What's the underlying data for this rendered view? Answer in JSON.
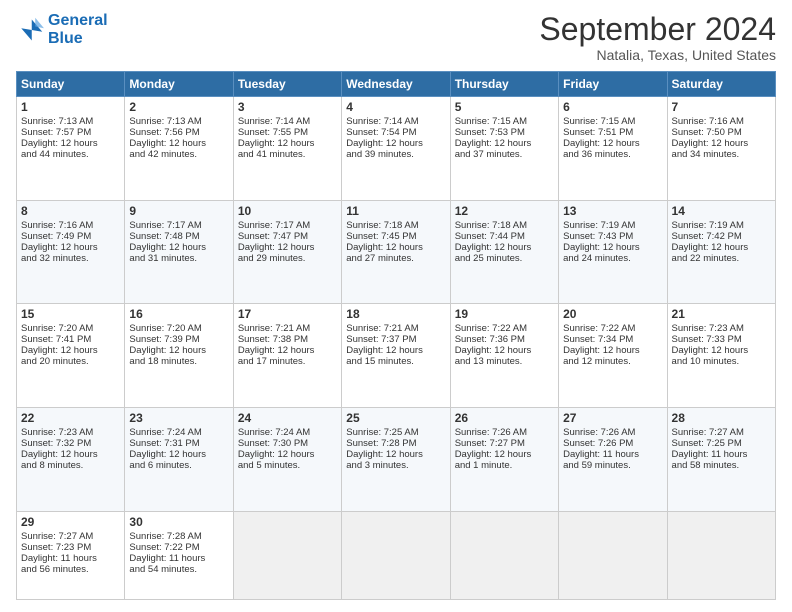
{
  "logo": {
    "line1": "General",
    "line2": "Blue"
  },
  "header": {
    "month": "September 2024",
    "location": "Natalia, Texas, United States"
  },
  "weekdays": [
    "Sunday",
    "Monday",
    "Tuesday",
    "Wednesday",
    "Thursday",
    "Friday",
    "Saturday"
  ],
  "weeks": [
    [
      {
        "day": "1",
        "lines": [
          "Sunrise: 7:13 AM",
          "Sunset: 7:57 PM",
          "Daylight: 12 hours",
          "and 44 minutes."
        ]
      },
      {
        "day": "2",
        "lines": [
          "Sunrise: 7:13 AM",
          "Sunset: 7:56 PM",
          "Daylight: 12 hours",
          "and 42 minutes."
        ]
      },
      {
        "day": "3",
        "lines": [
          "Sunrise: 7:14 AM",
          "Sunset: 7:55 PM",
          "Daylight: 12 hours",
          "and 41 minutes."
        ]
      },
      {
        "day": "4",
        "lines": [
          "Sunrise: 7:14 AM",
          "Sunset: 7:54 PM",
          "Daylight: 12 hours",
          "and 39 minutes."
        ]
      },
      {
        "day": "5",
        "lines": [
          "Sunrise: 7:15 AM",
          "Sunset: 7:53 PM",
          "Daylight: 12 hours",
          "and 37 minutes."
        ]
      },
      {
        "day": "6",
        "lines": [
          "Sunrise: 7:15 AM",
          "Sunset: 7:51 PM",
          "Daylight: 12 hours",
          "and 36 minutes."
        ]
      },
      {
        "day": "7",
        "lines": [
          "Sunrise: 7:16 AM",
          "Sunset: 7:50 PM",
          "Daylight: 12 hours",
          "and 34 minutes."
        ]
      }
    ],
    [
      {
        "day": "8",
        "lines": [
          "Sunrise: 7:16 AM",
          "Sunset: 7:49 PM",
          "Daylight: 12 hours",
          "and 32 minutes."
        ]
      },
      {
        "day": "9",
        "lines": [
          "Sunrise: 7:17 AM",
          "Sunset: 7:48 PM",
          "Daylight: 12 hours",
          "and 31 minutes."
        ]
      },
      {
        "day": "10",
        "lines": [
          "Sunrise: 7:17 AM",
          "Sunset: 7:47 PM",
          "Daylight: 12 hours",
          "and 29 minutes."
        ]
      },
      {
        "day": "11",
        "lines": [
          "Sunrise: 7:18 AM",
          "Sunset: 7:45 PM",
          "Daylight: 12 hours",
          "and 27 minutes."
        ]
      },
      {
        "day": "12",
        "lines": [
          "Sunrise: 7:18 AM",
          "Sunset: 7:44 PM",
          "Daylight: 12 hours",
          "and 25 minutes."
        ]
      },
      {
        "day": "13",
        "lines": [
          "Sunrise: 7:19 AM",
          "Sunset: 7:43 PM",
          "Daylight: 12 hours",
          "and 24 minutes."
        ]
      },
      {
        "day": "14",
        "lines": [
          "Sunrise: 7:19 AM",
          "Sunset: 7:42 PM",
          "Daylight: 12 hours",
          "and 22 minutes."
        ]
      }
    ],
    [
      {
        "day": "15",
        "lines": [
          "Sunrise: 7:20 AM",
          "Sunset: 7:41 PM",
          "Daylight: 12 hours",
          "and 20 minutes."
        ]
      },
      {
        "day": "16",
        "lines": [
          "Sunrise: 7:20 AM",
          "Sunset: 7:39 PM",
          "Daylight: 12 hours",
          "and 18 minutes."
        ]
      },
      {
        "day": "17",
        "lines": [
          "Sunrise: 7:21 AM",
          "Sunset: 7:38 PM",
          "Daylight: 12 hours",
          "and 17 minutes."
        ]
      },
      {
        "day": "18",
        "lines": [
          "Sunrise: 7:21 AM",
          "Sunset: 7:37 PM",
          "Daylight: 12 hours",
          "and 15 minutes."
        ]
      },
      {
        "day": "19",
        "lines": [
          "Sunrise: 7:22 AM",
          "Sunset: 7:36 PM",
          "Daylight: 12 hours",
          "and 13 minutes."
        ]
      },
      {
        "day": "20",
        "lines": [
          "Sunrise: 7:22 AM",
          "Sunset: 7:34 PM",
          "Daylight: 12 hours",
          "and 12 minutes."
        ]
      },
      {
        "day": "21",
        "lines": [
          "Sunrise: 7:23 AM",
          "Sunset: 7:33 PM",
          "Daylight: 12 hours",
          "and 10 minutes."
        ]
      }
    ],
    [
      {
        "day": "22",
        "lines": [
          "Sunrise: 7:23 AM",
          "Sunset: 7:32 PM",
          "Daylight: 12 hours",
          "and 8 minutes."
        ]
      },
      {
        "day": "23",
        "lines": [
          "Sunrise: 7:24 AM",
          "Sunset: 7:31 PM",
          "Daylight: 12 hours",
          "and 6 minutes."
        ]
      },
      {
        "day": "24",
        "lines": [
          "Sunrise: 7:24 AM",
          "Sunset: 7:30 PM",
          "Daylight: 12 hours",
          "and 5 minutes."
        ]
      },
      {
        "day": "25",
        "lines": [
          "Sunrise: 7:25 AM",
          "Sunset: 7:28 PM",
          "Daylight: 12 hours",
          "and 3 minutes."
        ]
      },
      {
        "day": "26",
        "lines": [
          "Sunrise: 7:26 AM",
          "Sunset: 7:27 PM",
          "Daylight: 12 hours",
          "and 1 minute."
        ]
      },
      {
        "day": "27",
        "lines": [
          "Sunrise: 7:26 AM",
          "Sunset: 7:26 PM",
          "Daylight: 11 hours",
          "and 59 minutes."
        ]
      },
      {
        "day": "28",
        "lines": [
          "Sunrise: 7:27 AM",
          "Sunset: 7:25 PM",
          "Daylight: 11 hours",
          "and 58 minutes."
        ]
      }
    ],
    [
      {
        "day": "29",
        "lines": [
          "Sunrise: 7:27 AM",
          "Sunset: 7:23 PM",
          "Daylight: 11 hours",
          "and 56 minutes."
        ]
      },
      {
        "day": "30",
        "lines": [
          "Sunrise: 7:28 AM",
          "Sunset: 7:22 PM",
          "Daylight: 11 hours",
          "and 54 minutes."
        ]
      },
      null,
      null,
      null,
      null,
      null
    ]
  ]
}
